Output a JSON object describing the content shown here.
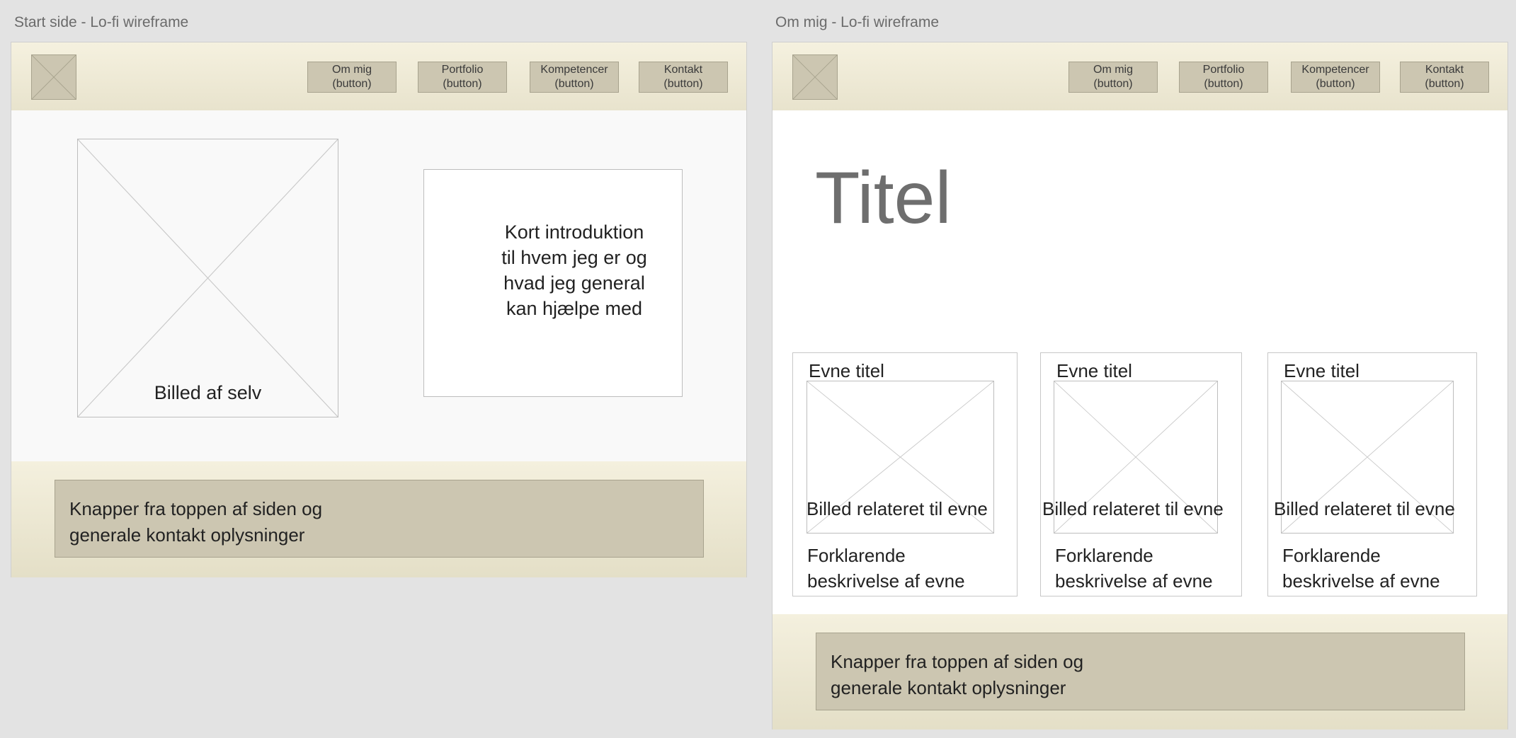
{
  "frames": [
    {
      "title": "Start side - Lo-fi wireframe",
      "nav": [
        {
          "label": "Om mig\n(button)"
        },
        {
          "label": "Portfolio\n(button)"
        },
        {
          "label": "Kompetencer\n(button)"
        },
        {
          "label": "Kontakt\n(button)"
        }
      ],
      "image_label": "Billed af selv",
      "intro_text": "Kort introduktion\ntil hvem jeg er og\nhvad jeg general\nkan hjælpe med",
      "footer_text": "Knapper fra toppen af siden og\ngenerale kontakt oplysninger"
    },
    {
      "title": "Om mig - Lo-fi wireframe",
      "nav": [
        {
          "label": "Om mig\n(button)"
        },
        {
          "label": "Portfolio\n(button)"
        },
        {
          "label": "Kompetencer\n(button)"
        },
        {
          "label": "Kontakt\n(button)"
        }
      ],
      "page_title": "Titel",
      "cards": [
        {
          "title": "Evne titel",
          "image_label": "Billed relateret til evne",
          "description": "Forklarende\nbeskrivelse af evne"
        },
        {
          "title": "Evne titel",
          "image_label": "Billed relateret til evne",
          "description": "Forklarende\nbeskrivelse af evne"
        },
        {
          "title": "Evne titel",
          "image_label": "Billed relateret til evne",
          "description": "Forklarende\nbeskrivelse af evne"
        }
      ],
      "footer_text": "Knapper fra toppen af siden og\ngenerale kontakt oplysninger"
    }
  ]
}
